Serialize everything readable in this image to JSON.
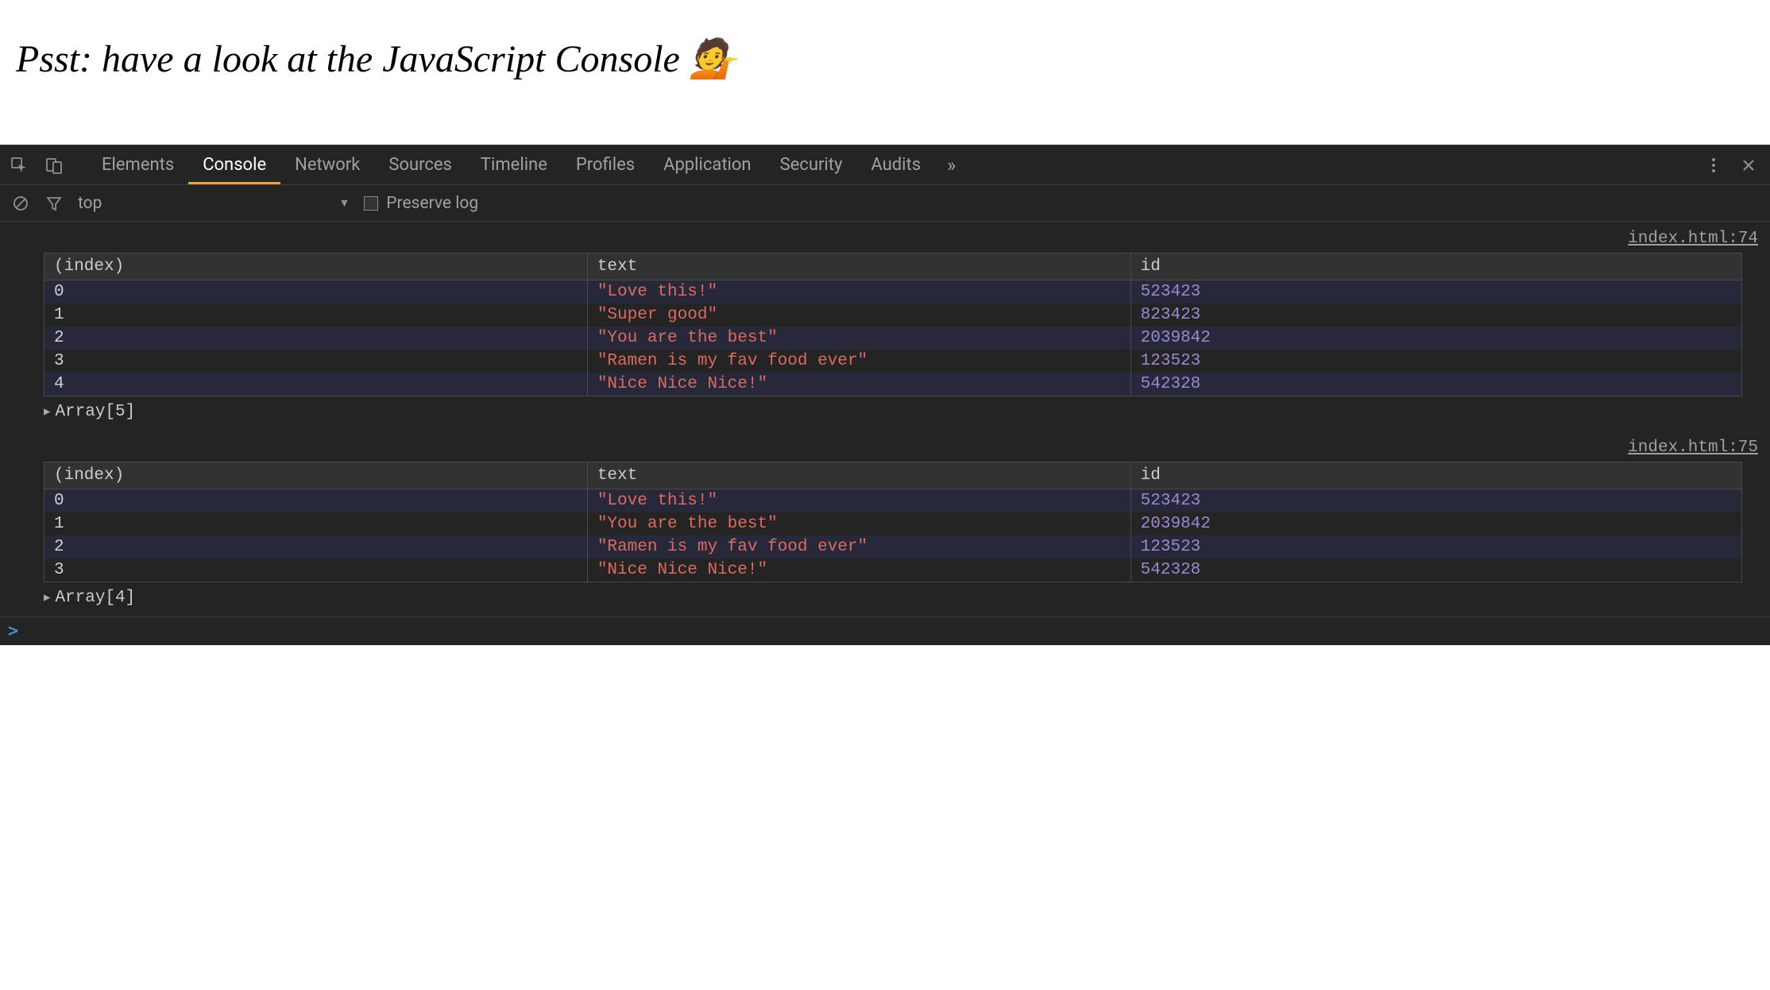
{
  "pageHeading": "Psst: have a look at the JavaScript Console 💁",
  "tabs": [
    "Elements",
    "Console",
    "Network",
    "Sources",
    "Timeline",
    "Profiles",
    "Application",
    "Security",
    "Audits"
  ],
  "activeTab": "Console",
  "overflowGlyph": "»",
  "toolbar": {
    "context": "top",
    "preserveLogLabel": "Preserve log"
  },
  "logs": [
    {
      "source": "index.html:74",
      "headers": [
        "(index)",
        "text",
        "id"
      ],
      "rows": [
        {
          "index": "0",
          "text": "\"Love this!\"",
          "id": "523423"
        },
        {
          "index": "1",
          "text": "\"Super good\"",
          "id": "823423"
        },
        {
          "index": "2",
          "text": "\"You are the best\"",
          "id": "2039842"
        },
        {
          "index": "3",
          "text": "\"Ramen is my fav food ever\"",
          "id": "123523"
        },
        {
          "index": "4",
          "text": "\"Nice Nice Nice!\"",
          "id": "542328"
        }
      ],
      "summary": "Array[5]"
    },
    {
      "source": "index.html:75",
      "headers": [
        "(index)",
        "text",
        "id"
      ],
      "rows": [
        {
          "index": "0",
          "text": "\"Love this!\"",
          "id": "523423"
        },
        {
          "index": "1",
          "text": "\"You are the best\"",
          "id": "2039842"
        },
        {
          "index": "2",
          "text": "\"Ramen is my fav food ever\"",
          "id": "123523"
        },
        {
          "index": "3",
          "text": "\"Nice Nice Nice!\"",
          "id": "542328"
        }
      ],
      "summary": "Array[4]"
    }
  ]
}
